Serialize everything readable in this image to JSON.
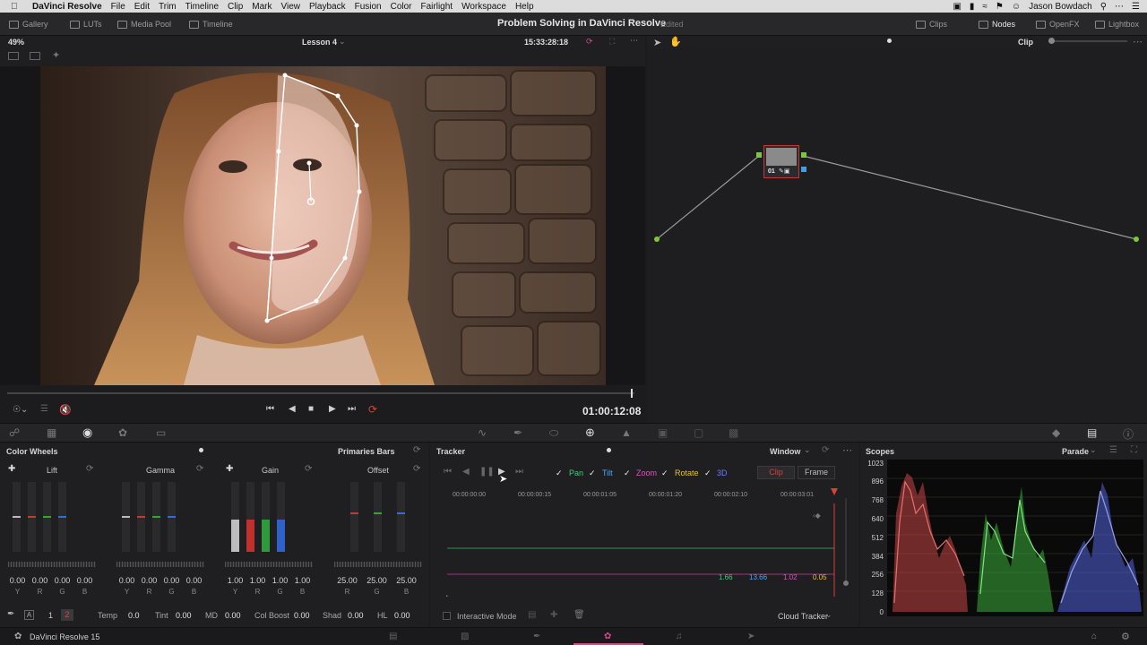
{
  "menubar": {
    "app": "DaVinci Resolve",
    "items": [
      "File",
      "Edit",
      "Trim",
      "Timeline",
      "Clip",
      "Mark",
      "View",
      "Playback",
      "Fusion",
      "Color",
      "Fairlight",
      "Workspace",
      "Help"
    ],
    "user": "Jason Bowdach"
  },
  "toolbar": {
    "left_buttons": [
      "Gallery",
      "LUTs",
      "Media Pool",
      "Timeline"
    ],
    "project_title": "Problem Solving in DaVinci Resolve",
    "status": "Edited",
    "right_buttons": [
      "Clips",
      "Nodes",
      "OpenFX",
      "Lightbox"
    ]
  },
  "viewer": {
    "zoom": "49%",
    "timeline_name": "Lesson 4",
    "source_timecode": "15:33:28:18",
    "record_timecode": "01:00:12:08"
  },
  "node_editor": {
    "mode": "Clip",
    "node_label": "01"
  },
  "color_wheels": {
    "title": "Color Wheels",
    "mode": "Primaries Bars",
    "wheels": [
      {
        "name": "Lift",
        "values": [
          "0.00",
          "0.00",
          "0.00",
          "0.00"
        ],
        "channels": [
          "Y",
          "R",
          "G",
          "B"
        ]
      },
      {
        "name": "Gamma",
        "values": [
          "0.00",
          "0.00",
          "0.00",
          "0.00"
        ],
        "channels": [
          "Y",
          "R",
          "G",
          "B"
        ]
      },
      {
        "name": "Gain",
        "values": [
          "1.00",
          "1.00",
          "1.00",
          "1.00"
        ],
        "channels": [
          "Y",
          "R",
          "G",
          "B"
        ]
      },
      {
        "name": "Offset",
        "values": [
          "25.00",
          "25.00",
          "25.00"
        ],
        "channels": [
          "R",
          "G",
          "B"
        ]
      }
    ],
    "page_1": "1",
    "page_2": "2",
    "adjust": [
      {
        "label": "Temp",
        "value": "0.0"
      },
      {
        "label": "Tint",
        "value": "0.00"
      },
      {
        "label": "MD",
        "value": "0.00"
      },
      {
        "label": "Col Boost",
        "value": "0.00"
      },
      {
        "label": "Shad",
        "value": "0.00"
      },
      {
        "label": "HL",
        "value": "0.00"
      }
    ]
  },
  "tracker": {
    "title": "Tracker",
    "mode": "Window",
    "options": [
      {
        "label": "Pan",
        "color": "#3fd07a"
      },
      {
        "label": "Tilt",
        "color": "#4aa8ff"
      },
      {
        "label": "Zoom",
        "color": "#e052c8"
      },
      {
        "label": "Rotate",
        "color": "#e8c23a"
      },
      {
        "label": "3D",
        "color": "#6f7bff"
      }
    ],
    "clip_label": "Clip",
    "frame_label": "Frame",
    "ruler": [
      "00:00:00:00",
      "00:00:00:15",
      "00:00:01:05",
      "00:00:01:20",
      "00:00:02:10",
      "00:00:03:01"
    ],
    "values": [
      {
        "v": "1.66",
        "color": "#3fd07a"
      },
      {
        "v": "13.66",
        "color": "#4aa8ff"
      },
      {
        "v": "1.02",
        "color": "#e052c8"
      },
      {
        "v": "0.05",
        "color": "#e8c23a"
      }
    ],
    "interactive_mode": "Interactive Mode",
    "tracker_type": "Cloud Tracker"
  },
  "scopes": {
    "title": "Scopes",
    "mode": "Parade",
    "ticks": [
      "1023",
      "896",
      "768",
      "640",
      "512",
      "384",
      "256",
      "128",
      "0"
    ]
  },
  "status": {
    "app_version": "DaVinci Resolve 15"
  }
}
